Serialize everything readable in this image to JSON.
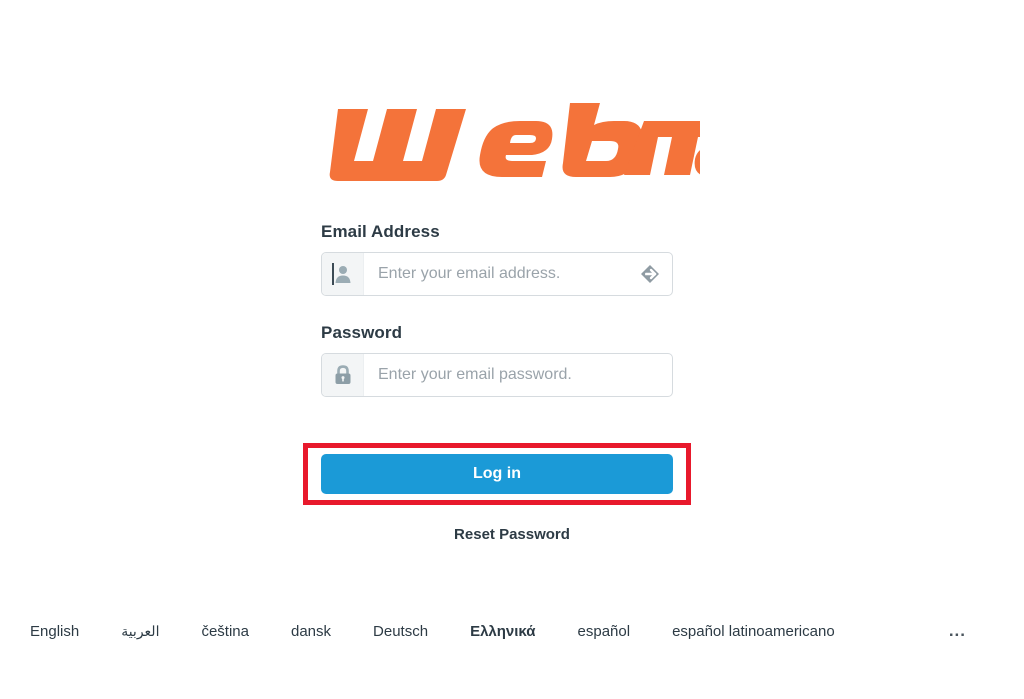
{
  "brand": {
    "logo_text": "Webmail",
    "logo_color": "#f4733a"
  },
  "form": {
    "email": {
      "label": "Email Address",
      "placeholder": "Enter your email address.",
      "value": "",
      "icon": "user-icon",
      "action_icon": "login-arrow-icon",
      "focused": true
    },
    "password": {
      "label": "Password",
      "placeholder": "Enter your email password.",
      "value": "",
      "icon": "lock-icon"
    },
    "submit": {
      "label": "Log in",
      "color": "#1b9ad7",
      "highlight_color": "#e8192c",
      "highlighted": true
    },
    "reset_link": "Reset Password"
  },
  "languages": {
    "items": [
      {
        "label": "English",
        "active": false,
        "rtl": false
      },
      {
        "label": "العربية",
        "active": false,
        "rtl": true
      },
      {
        "label": "čeština",
        "active": false,
        "rtl": false
      },
      {
        "label": "dansk",
        "active": false,
        "rtl": false
      },
      {
        "label": "Deutsch",
        "active": false,
        "rtl": false
      },
      {
        "label": "Ελληνικά",
        "active": true,
        "rtl": false
      },
      {
        "label": "español",
        "active": false,
        "rtl": false
      },
      {
        "label": "español latinoamericano",
        "active": false,
        "rtl": false
      }
    ],
    "more_label": "..."
  }
}
